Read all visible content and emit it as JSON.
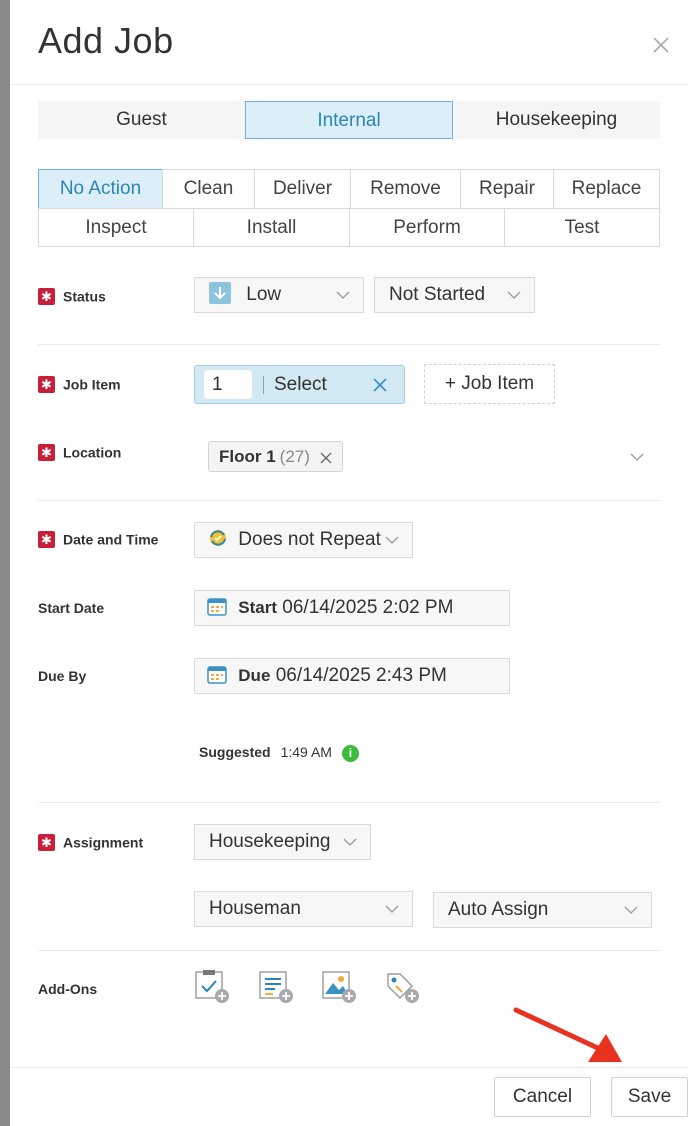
{
  "modal": {
    "title": "Add Job"
  },
  "categories": [
    "Guest",
    "Internal",
    "Housekeeping"
  ],
  "actions": {
    "row1": [
      "No Action",
      "Clean",
      "Deliver",
      "Remove",
      "Repair",
      "Replace"
    ],
    "row2": [
      "Inspect",
      "Install",
      "Perform",
      "Test"
    ]
  },
  "status": {
    "label": "Status",
    "priority": "Low",
    "state": "Not Started"
  },
  "job_item": {
    "label": "Job Item",
    "quantity": "1",
    "select_text": "Select",
    "add_button": "+ Job Item"
  },
  "location": {
    "label": "Location",
    "chip_name": "Floor 1",
    "chip_count": "(27)"
  },
  "date_time": {
    "label": "Date and Time",
    "repeat": "Does not Repeat",
    "start_label": "Start Date",
    "start_prefix": "Start",
    "start_value": "06/14/2025 2:02 PM",
    "due_label": "Due By",
    "due_prefix": "Due",
    "due_value": "06/14/2025 2:43 PM",
    "suggested_label": "Suggested",
    "suggested_value": "1:49 AM"
  },
  "assignment": {
    "label": "Assignment",
    "department": "Housekeeping",
    "role": "Houseman",
    "mode": "Auto Assign"
  },
  "addons": {
    "label": "Add-Ons"
  },
  "footer": {
    "cancel": "Cancel",
    "save": "Save"
  },
  "colors": {
    "required": "#c8203a",
    "active_bg": "#dceef7",
    "active_text": "#2a86b8",
    "annotation_arrow": "#e8321f"
  }
}
